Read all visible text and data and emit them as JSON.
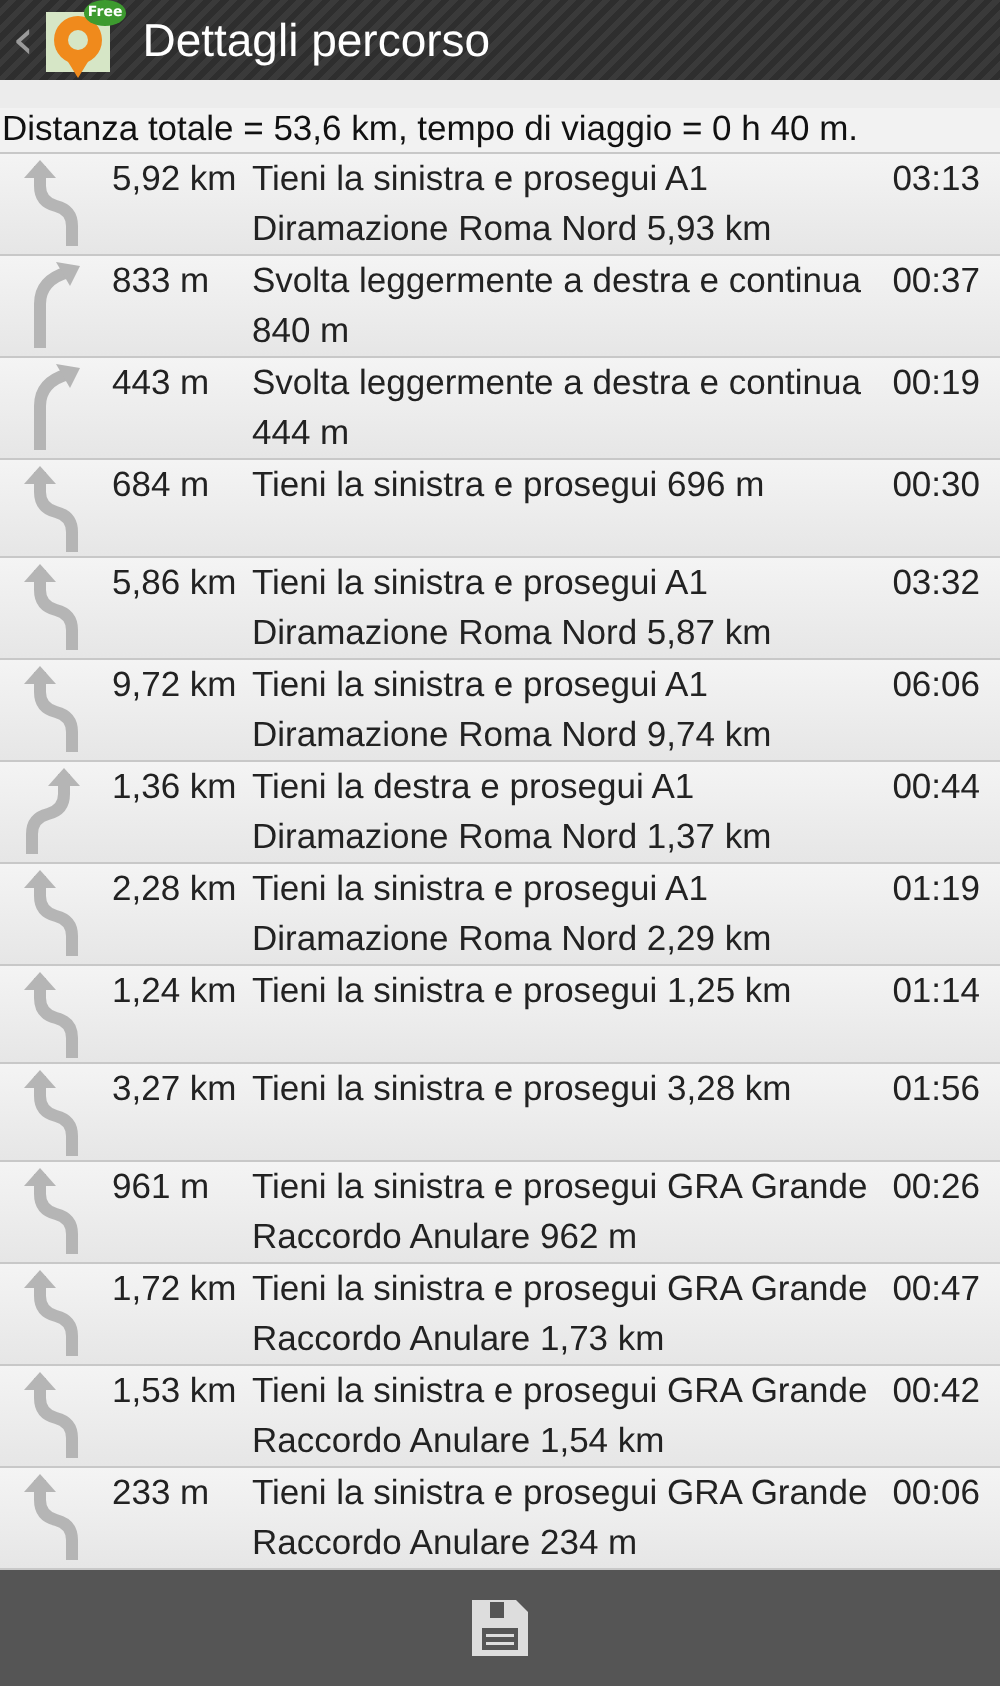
{
  "action_bar": {
    "back": "‹",
    "badge": "Free",
    "title": "Dettagli percorso"
  },
  "summary": "Distanza totale = 53,6 km, tempo di viaggio = 0 h 40 m.",
  "steps": [
    {
      "kind": "keep-left",
      "distance": "5,92 km",
      "instruction": "Tieni la sinistra e prosegui A1 Diramazione Roma Nord 5,93 km",
      "time": "03:13"
    },
    {
      "kind": "slight-right",
      "distance": "833 m",
      "instruction": "Svolta leggermente a destra e continua  840 m",
      "time": "00:37"
    },
    {
      "kind": "slight-right",
      "distance": "443 m",
      "instruction": "Svolta leggermente a destra e continua  444 m",
      "time": "00:19"
    },
    {
      "kind": "keep-left",
      "distance": "684 m",
      "instruction": "Tieni la sinistra e prosegui  696 m",
      "time": "00:30"
    },
    {
      "kind": "keep-left",
      "distance": "5,86 km",
      "instruction": "Tieni la sinistra e prosegui A1 Diramazione Roma Nord 5,87 km",
      "time": "03:32"
    },
    {
      "kind": "keep-left",
      "distance": "9,72 km",
      "instruction": "Tieni la sinistra e prosegui A1 Diramazione Roma Nord 9,74 km",
      "time": "06:06"
    },
    {
      "kind": "keep-right",
      "distance": "1,36 km",
      "instruction": "Tieni la destra e prosegui A1 Diramazione Roma Nord 1,37 km",
      "time": "00:44"
    },
    {
      "kind": "keep-left",
      "distance": "2,28 km",
      "instruction": "Tieni la sinistra e prosegui A1 Diramazione Roma Nord 2,29 km",
      "time": "01:19"
    },
    {
      "kind": "keep-left",
      "distance": "1,24 km",
      "instruction": "Tieni la sinistra e prosegui  1,25 km",
      "time": "01:14"
    },
    {
      "kind": "keep-left",
      "distance": "3,27 km",
      "instruction": "Tieni la sinistra e prosegui  3,28 km",
      "time": "01:56"
    },
    {
      "kind": "keep-left",
      "distance": "961 m",
      "instruction": "Tieni la sinistra e prosegui GRA Grande Raccordo Anulare 962 m",
      "time": "00:26"
    },
    {
      "kind": "keep-left",
      "distance": "1,72 km",
      "instruction": "Tieni la sinistra e prosegui GRA Grande Raccordo Anulare 1,73 km",
      "time": "00:47"
    },
    {
      "kind": "keep-left",
      "distance": "1,53 km",
      "instruction": "Tieni la sinistra e prosegui GRA Grande Raccordo Anulare 1,54 km",
      "time": "00:42"
    },
    {
      "kind": "keep-left",
      "distance": "233 m",
      "instruction": "Tieni la sinistra e prosegui GRA Grande Raccordo Anulare 234 m",
      "time": "00:06"
    }
  ]
}
